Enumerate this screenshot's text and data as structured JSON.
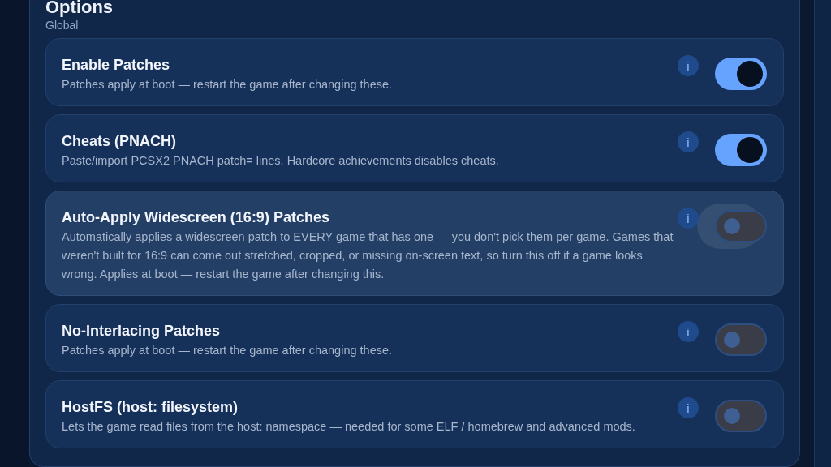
{
  "panel": {
    "title": "Options",
    "subtitle": "Global"
  },
  "options": [
    {
      "title": "Enable Patches",
      "description": "Patches apply at boot — restart the game after changing these.",
      "info": "i",
      "on": true,
      "highlighted": false
    },
    {
      "title": "Cheats (PNACH)",
      "description": "Paste/import PCSX2 PNACH patch= lines. Hardcore achievements disables cheats.",
      "info": "i",
      "on": true,
      "highlighted": false
    },
    {
      "title": "Auto-Apply Widescreen (16:9) Patches",
      "description": "Automatically applies a widescreen patch to EVERY game that has one — you don't pick them per game. Games that weren't built for 16:9 can come out stretched, cropped, or missing on-screen text, so turn this off if a game looks wrong. Applies at boot — restart the game after changing this.",
      "info": "i",
      "on": false,
      "highlighted": true
    },
    {
      "title": "No-Interlacing Patches",
      "description": "Patches apply at boot — restart the game after changing these.",
      "info": "i",
      "on": false,
      "highlighted": false
    },
    {
      "title": "HostFS (host: filesystem)",
      "description": "Lets the game read files from the host: namespace — needed for some ELF / homebrew and advanced mods.",
      "info": "i",
      "on": false,
      "highlighted": false
    }
  ]
}
